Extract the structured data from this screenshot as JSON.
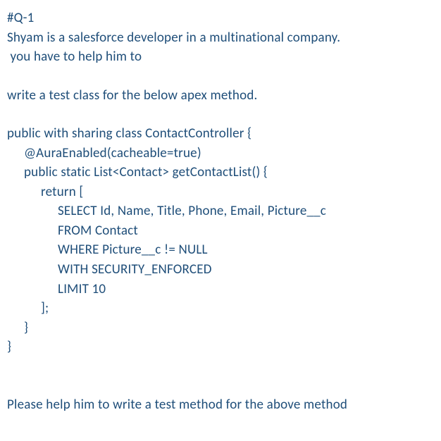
{
  "header": "#Q-1",
  "intro_line1": "Shyam is a salesforce developer in a multinational company.",
  "intro_line2": " you have to help him to",
  "task": "write a test class for the below apex method.",
  "code": {
    "l1": "public with sharing class ContactController {",
    "l2": "@AuraEnabled(cacheable=true)",
    "l3": "public static List<Contact> getContactList() {",
    "l4": "return [",
    "l5": "SELECT Id, Name, Title, Phone, Email, Picture__c",
    "l6": "FROM Contact",
    "l7": "WHERE Picture__c != NULL",
    "l8": "WITH SECURITY_ENFORCED",
    "l9": "LIMIT 10",
    "l10": "];",
    "l11": "}",
    "l12": "}"
  },
  "footer": "Please help him to write a test method for the above method"
}
